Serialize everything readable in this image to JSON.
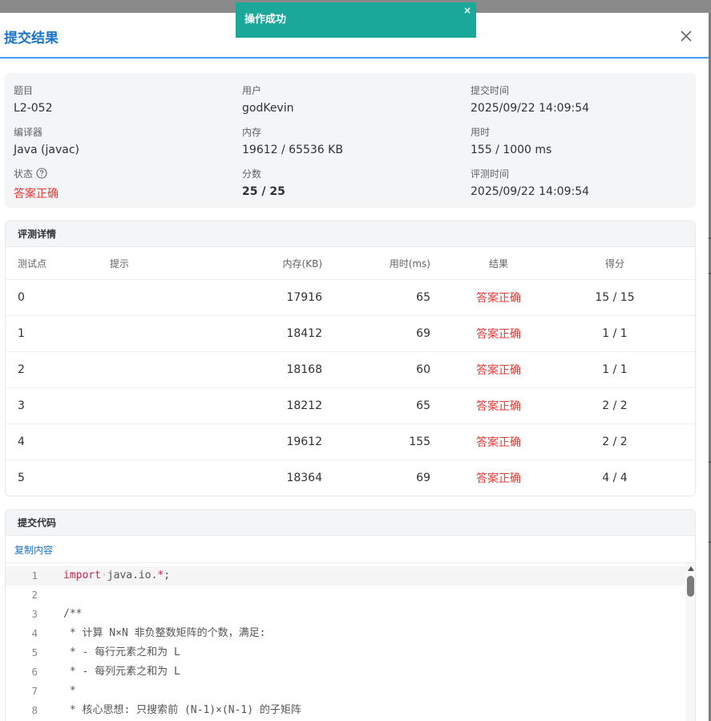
{
  "dialog": {
    "title": "提交结果"
  },
  "toast": {
    "message": "操作成功",
    "close_glyph": "×"
  },
  "info": {
    "problem": {
      "label": "题目",
      "value": "L2-052"
    },
    "user": {
      "label": "用户",
      "value": "godKevin"
    },
    "submit_time": {
      "label": "提交时间",
      "value": "2025/09/22 14:09:54"
    },
    "compiler": {
      "label": "编译器",
      "value": "Java (javac)"
    },
    "memory": {
      "label": "内存",
      "value": "19612 / 65536 KB"
    },
    "time_used": {
      "label": "用时",
      "value": "155 / 1000 ms"
    },
    "status": {
      "label": "状态",
      "value": "答案正确"
    },
    "score": {
      "label": "分数",
      "value": "25 / 25"
    },
    "judge_time": {
      "label": "评测时间",
      "value": "2025/09/22 14:09:54"
    }
  },
  "judge": {
    "title": "评测详情",
    "columns": [
      "测试点",
      "提示",
      "内存(KB)",
      "用时(ms)",
      "结果",
      "得分"
    ],
    "rows": [
      {
        "id": "0",
        "hint": "",
        "memory": "17916",
        "time": "65",
        "result": "答案正确",
        "score": "15 / 15"
      },
      {
        "id": "1",
        "hint": "",
        "memory": "18412",
        "time": "69",
        "result": "答案正确",
        "score": "1 / 1"
      },
      {
        "id": "2",
        "hint": "",
        "memory": "18168",
        "time": "60",
        "result": "答案正确",
        "score": "1 / 1"
      },
      {
        "id": "3",
        "hint": "",
        "memory": "18212",
        "time": "65",
        "result": "答案正确",
        "score": "2 / 2"
      },
      {
        "id": "4",
        "hint": "",
        "memory": "19612",
        "time": "155",
        "result": "答案正确",
        "score": "2 / 2"
      },
      {
        "id": "5",
        "hint": "",
        "memory": "18364",
        "time": "69",
        "result": "答案正确",
        "score": "4 / 4"
      }
    ]
  },
  "code": {
    "title": "提交代码",
    "copy_label": "复制内容",
    "lines": [
      {
        "n": "1",
        "text": "import java.io.*;"
      },
      {
        "n": "2",
        "text": ""
      },
      {
        "n": "3",
        "text": "/**"
      },
      {
        "n": "4",
        "text": " * 计算 N×N 非负整数矩阵的个数，满足:"
      },
      {
        "n": "5",
        "text": " * - 每行元素之和为 L"
      },
      {
        "n": "6",
        "text": " * - 每列元素之和为 L"
      },
      {
        "n": "7",
        "text": " *"
      },
      {
        "n": "8",
        "text": " * 核心思想: 只搜索前 (N-1)×(N-1) 的子矩阵"
      }
    ]
  },
  "icons": {
    "close": "close-icon",
    "help": "question-circle-icon",
    "scroll_up": "scroll-up-arrow-icon"
  },
  "colors": {
    "accent": "#1a73c9",
    "accepted": "#e53935",
    "toast": "#1aa89a"
  }
}
